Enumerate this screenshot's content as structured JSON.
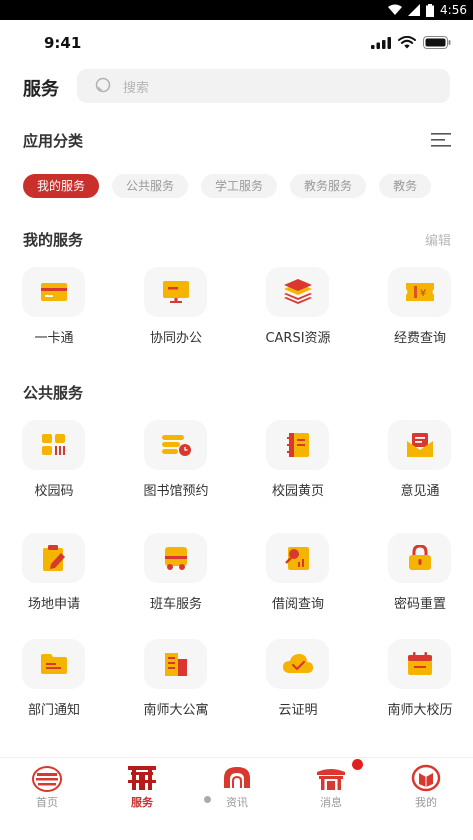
{
  "android_status": {
    "time": "4:56"
  },
  "ios_status": {
    "time": "9:41"
  },
  "header": {
    "title": "服务",
    "search_placeholder": "搜索"
  },
  "categories": {
    "title": "应用分类",
    "chips": [
      "我的服务",
      "公共服务",
      "学工服务",
      "教务服务",
      "教务"
    ]
  },
  "my_services": {
    "title": "我的服务",
    "edit_label": "编辑",
    "items": [
      {
        "label": "一卡通",
        "icon": "card-icon"
      },
      {
        "label": "协同办公",
        "icon": "monitor-icon"
      },
      {
        "label": "CARSI资源",
        "icon": "layers-icon"
      },
      {
        "label": "经费查询",
        "icon": "ticket-icon"
      }
    ]
  },
  "public_services": {
    "title": "公共服务",
    "items": [
      {
        "label": "校园码",
        "icon": "qrcode-icon"
      },
      {
        "label": "图书馆预约",
        "icon": "library-icon"
      },
      {
        "label": "校园黄页",
        "icon": "book-icon"
      },
      {
        "label": "意见通",
        "icon": "mail-icon"
      },
      {
        "label": "场地申请",
        "icon": "clipboard-icon"
      },
      {
        "label": "班车服务",
        "icon": "bus-icon"
      },
      {
        "label": "借阅查询",
        "icon": "chart-icon"
      },
      {
        "label": "密码重置",
        "icon": "lock-icon"
      },
      {
        "label": "部门通知",
        "icon": "folder-icon"
      },
      {
        "label": "南师大公寓",
        "icon": "building-icon"
      },
      {
        "label": "云证明",
        "icon": "cloud-icon"
      },
      {
        "label": "南师大校历",
        "icon": "calendar-icon"
      }
    ]
  },
  "bottom_nav": {
    "items": [
      "首页",
      "服务",
      "资讯",
      "消息",
      "我的"
    ],
    "active": "服务"
  },
  "colors": {
    "accent": "#c9302c",
    "icon_yellow": "#f5b400",
    "icon_red": "#d8382e"
  }
}
